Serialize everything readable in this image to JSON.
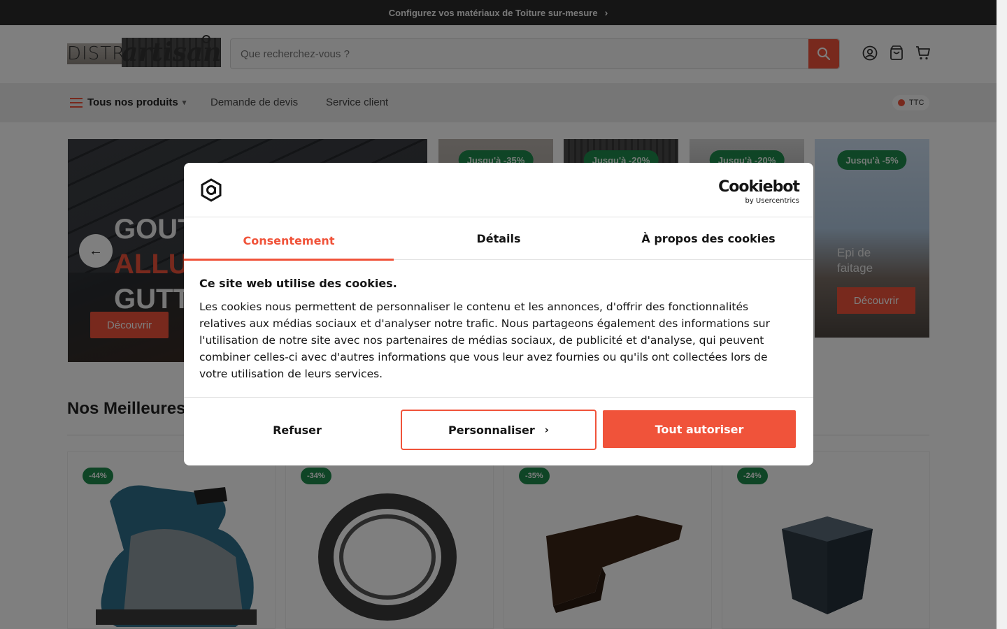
{
  "top_banner": {
    "text": "Configurez vos matériaux de Toiture sur-mesure",
    "chevron": "›"
  },
  "header": {
    "logo_left": "DISTRI",
    "logo_right": "artisan",
    "search_placeholder": "Que recherchez-vous ?",
    "icons": [
      "account-icon",
      "bag-icon",
      "cart-icon"
    ]
  },
  "nav": {
    "all_products": "Tous nos produits",
    "quote": "Demande de devis",
    "service": "Service client",
    "ttc": "TTC"
  },
  "hero": {
    "main_title_1": "GOUTTIÈRES",
    "main_title_2": "ALLU",
    "main_title_3": "GUTTERS",
    "main_button": "Découvrir",
    "tiles": [
      {
        "badge": "Jusqu'à -35%"
      },
      {
        "badge": "Jusqu'à -20%"
      },
      {
        "badge": "Jusqu'à -20%"
      },
      {
        "badge": "Jusqu'à -5%",
        "label": "Epi de faitage",
        "button": "Découvrir"
      }
    ]
  },
  "best_sellers": {
    "title": "Nos Meilleures Ventes",
    "products": [
      {
        "badge": "-44%"
      },
      {
        "badge": "-34%"
      },
      {
        "badge": "-35%"
      },
      {
        "badge": "-24%"
      }
    ]
  },
  "cookie_dialog": {
    "brand_main": "Cookiebot",
    "brand_sub": "by Usercentrics",
    "tabs": [
      "Consentement",
      "Détails",
      "À propos des cookies"
    ],
    "active_tab": "Consentement",
    "heading": "Ce site web utilise des cookies.",
    "body": "Les cookies nous permettent de personnaliser le contenu et les annonces, d'offrir des fonctionnalités relatives aux médias sociaux et d'analyser notre trafic. Nous partageons également des informations sur l'utilisation de notre site avec nos partenaires de médias sociaux, de publicité et d'analyse, qui peuvent combiner celles-ci avec d'autres informations que vous leur avez fournies ou qu'ils ont collectées lors de votre utilisation de leurs services.",
    "buttons": {
      "refuse": "Refuser",
      "customize": "Personnaliser",
      "allow_all": "Tout autoriser"
    }
  },
  "colors": {
    "accent": "#f0533a",
    "badge_green": "#1f8a4c",
    "topbar": "#2b2b2b"
  }
}
